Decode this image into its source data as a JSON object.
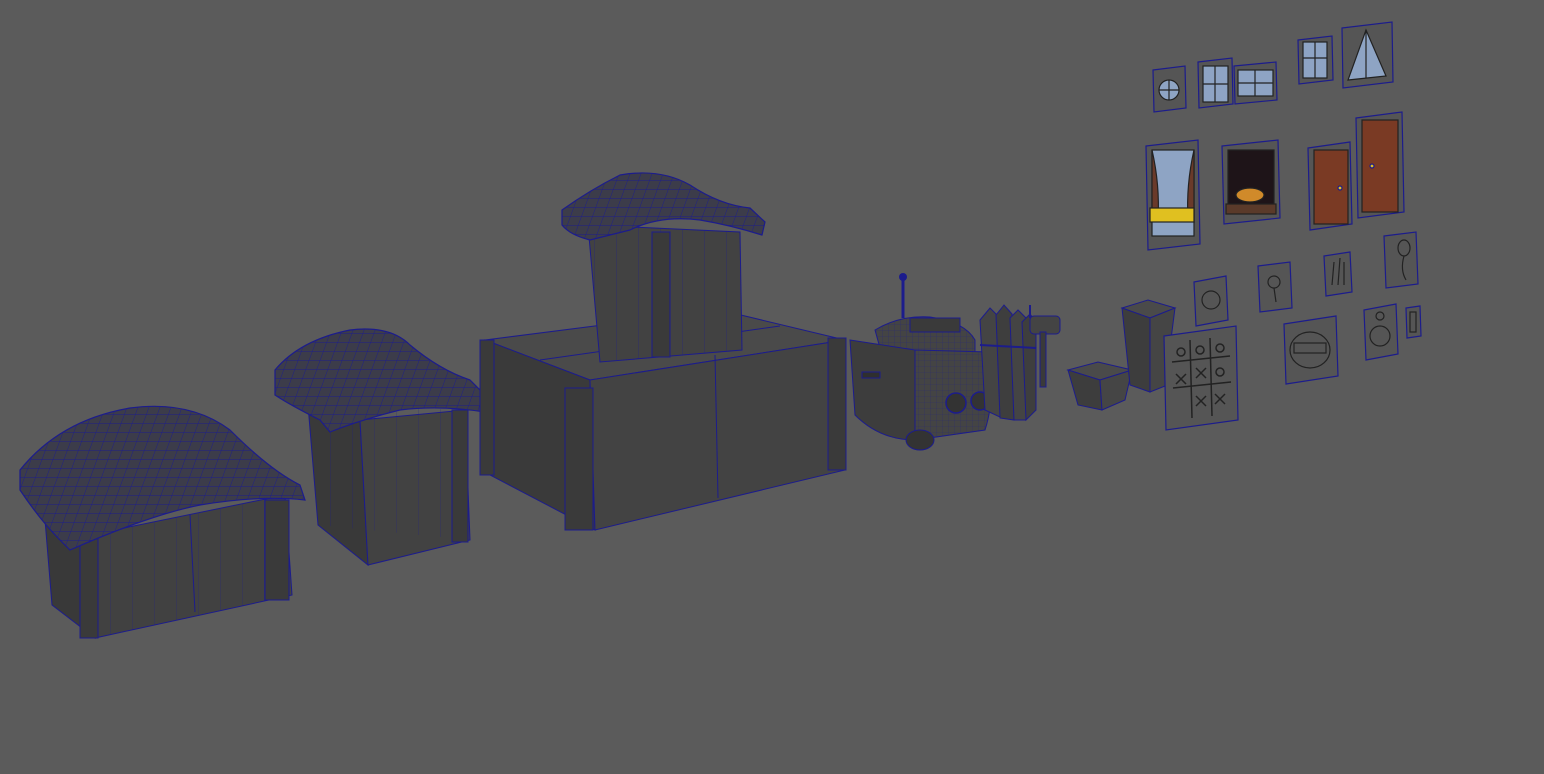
{
  "viewport": {
    "background": "#5b5b5b",
    "wire_color": "#1c1c8c",
    "face_color": "#3f3f3f",
    "face_light": "#474747",
    "card_color": "#545454"
  },
  "objects": [
    {
      "name": "small-doghouse",
      "kind": "house"
    },
    {
      "name": "medium-doghouse",
      "kind": "house"
    },
    {
      "name": "large-building",
      "kind": "building"
    },
    {
      "name": "robot-vehicle",
      "kind": "vehicle"
    },
    {
      "name": "wooden-fence",
      "kind": "fence"
    },
    {
      "name": "mailbox",
      "kind": "mailbox"
    },
    {
      "name": "short-planter",
      "kind": "planter"
    },
    {
      "name": "tall-planter",
      "kind": "planter"
    }
  ],
  "texture_cards": [
    {
      "name": "round-window-card",
      "icon": "round-window-icon"
    },
    {
      "name": "four-pane-window-card",
      "icon": "four-pane-window-icon"
    },
    {
      "name": "wide-window-card",
      "icon": "wide-window-icon"
    },
    {
      "name": "tall-window-card",
      "icon": "tall-window-icon"
    },
    {
      "name": "triangle-window-card",
      "icon": "triangle-window-icon"
    },
    {
      "name": "curtain-window-card",
      "icon": "curtain-window-icon"
    },
    {
      "name": "pie-window-card",
      "icon": "pie-window-icon"
    },
    {
      "name": "short-door-card",
      "icon": "door-icon"
    },
    {
      "name": "tall-door-card",
      "icon": "door-icon"
    },
    {
      "name": "sun-doodle-card",
      "icon": "sun-doodle-icon"
    },
    {
      "name": "flower-doodle-card",
      "icon": "flower-doodle-icon"
    },
    {
      "name": "hand-doodle-card",
      "icon": "hand-doodle-icon"
    },
    {
      "name": "balloon-doodle-card",
      "icon": "balloon-doodle-icon"
    },
    {
      "name": "tic-tac-toe-card",
      "icon": "tic-tac-toe-icon"
    },
    {
      "name": "sign-doodle-card",
      "icon": "sign-doodle-icon"
    },
    {
      "name": "bag-doodle-card",
      "icon": "bag-doodle-icon"
    },
    {
      "name": "small-sticker-card",
      "icon": "sticker-icon"
    }
  ]
}
